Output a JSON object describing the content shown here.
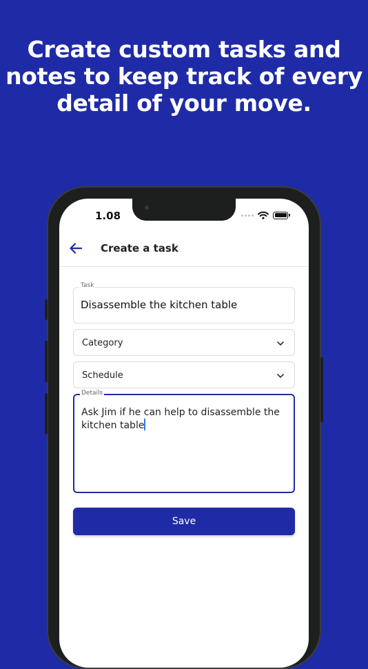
{
  "headline": "Create custom tasks and notes to keep track of every detail of your move.",
  "status": {
    "time": "1.08"
  },
  "appbar": {
    "title": "Create a task",
    "back_icon": "arrow-left-icon"
  },
  "form": {
    "task": {
      "label": "Task",
      "value": "Disassemble the kitchen table"
    },
    "category": {
      "label": "Category",
      "icon": "chevron-down-icon"
    },
    "schedule": {
      "label": "Schedule",
      "icon": "chevron-down-icon"
    },
    "details": {
      "label": "Details",
      "value": "Ask Jim if he can help to disassemble the kitchen table"
    },
    "save_label": "Save"
  },
  "colors": {
    "brand": "#1f2ba6",
    "caret": "#2a7de1"
  }
}
